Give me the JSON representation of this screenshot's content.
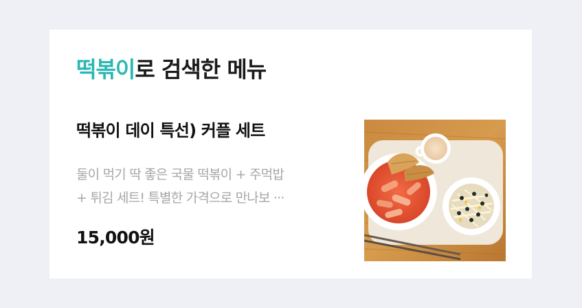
{
  "search_result": {
    "keyword": "떡볶이",
    "heading_suffix": "로 검색한 메뉴"
  },
  "menu_item": {
    "name": "떡볶이 데이 특선) 커플 세트",
    "description_lines": [
      "둘이 먹기 딱 좋은 국물 떡볶이 + 주먹밥",
      "+ 튀김 세트! 특별한 가격으로 만나보 ···"
    ],
    "price": "15,000원"
  },
  "colors": {
    "accent": "#2bb7b3",
    "background": "#eef0f5",
    "card": "#ffffff"
  },
  "icons": {
    "thumbnail": "food-photo"
  }
}
